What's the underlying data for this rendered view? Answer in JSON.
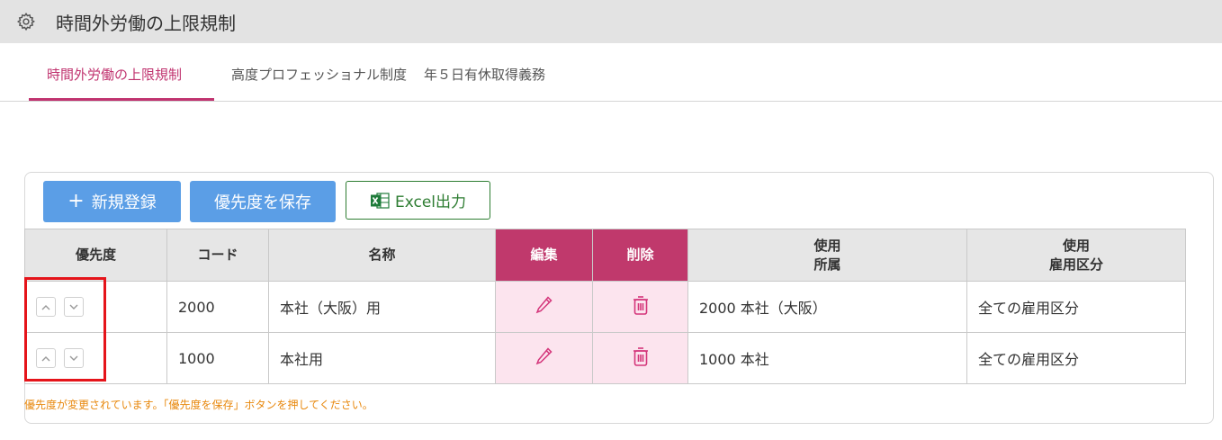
{
  "header": {
    "title": "時間外労働の上限規制",
    "icon": "gear-icon"
  },
  "tabs": [
    {
      "label": "時間外労働の上限規制",
      "active": true
    },
    {
      "label": "高度プロフェッショナル制度",
      "active": false
    },
    {
      "label": "年５日有休取得義務",
      "active": false
    }
  ],
  "toolbar": {
    "new_label": "新規登録",
    "save_priority_label": "優先度を保存",
    "excel_label": "Excel出力"
  },
  "table": {
    "headers": {
      "priority": "優先度",
      "code": "コード",
      "name": "名称",
      "edit": "編集",
      "delete": "削除",
      "usage_dept_1": "使用",
      "usage_dept_2": "所属",
      "usage_emp_1": "使用",
      "usage_emp_2": "雇用区分"
    },
    "rows": [
      {
        "code": "2000",
        "name": "本社（大阪）用",
        "dept": "2000 本社（大阪）",
        "employment": "全ての雇用区分"
      },
      {
        "code": "1000",
        "name": "本社用",
        "dept": "1000 本社",
        "employment": "全ての雇用区分"
      }
    ]
  },
  "message": "優先度が変更されています。「優先度を保存」ボタンを押してください。",
  "colors": {
    "accent": "#c0336f",
    "header_pink": "#c0396c",
    "cell_pink": "#fce4ee",
    "button_blue": "#5b9ee6",
    "excel_green": "#2e7d32",
    "warning": "#e8880d",
    "highlight": "#e5141a"
  }
}
